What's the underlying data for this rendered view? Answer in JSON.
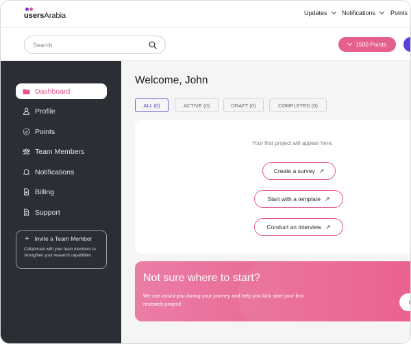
{
  "brand": {
    "name_bold": "users",
    "name_light": "Arabia"
  },
  "topnav": {
    "updates": "Updates",
    "notifications": "Notifications",
    "points": "Points"
  },
  "search": {
    "placeholder": "Search"
  },
  "header": {
    "points_label": "1500 Points"
  },
  "sidebar": {
    "items": [
      {
        "label": "Dashboard",
        "icon": "folder-icon",
        "active": true
      },
      {
        "label": "Profile",
        "icon": "user-icon"
      },
      {
        "label": "Points",
        "icon": "badge-icon"
      },
      {
        "label": "Team Members",
        "icon": "team-icon"
      },
      {
        "label": "Notifications",
        "icon": "bell-icon"
      },
      {
        "label": "Billing",
        "icon": "billing-icon"
      },
      {
        "label": "Support",
        "icon": "support-icon"
      }
    ],
    "invite": {
      "title": "Invite a Team Member",
      "description": "Collaborate with your team members to strengthen your research capabilities"
    }
  },
  "main": {
    "welcome": "Welcome, John",
    "tabs": [
      {
        "label": "ALL (0)",
        "active": true
      },
      {
        "label": "ACTIVE (0)"
      },
      {
        "label": "DRAFT (0)"
      },
      {
        "label": "COMPLETED (0)"
      }
    ],
    "empty_text": "Your first project will appear here.",
    "actions": [
      {
        "label": "Create a survey"
      },
      {
        "label": "Start with a template"
      },
      {
        "label": "Conduct an interview"
      }
    ],
    "banner": {
      "title": "Not sure where to start?",
      "description": "We can assist you during your journey and help you kick start your first research project!",
      "button_label": "C"
    }
  },
  "colors": {
    "accent_pink": "#e5608d",
    "accent_purple": "#5b3fd8",
    "sidebar_bg": "#2c2e35"
  }
}
